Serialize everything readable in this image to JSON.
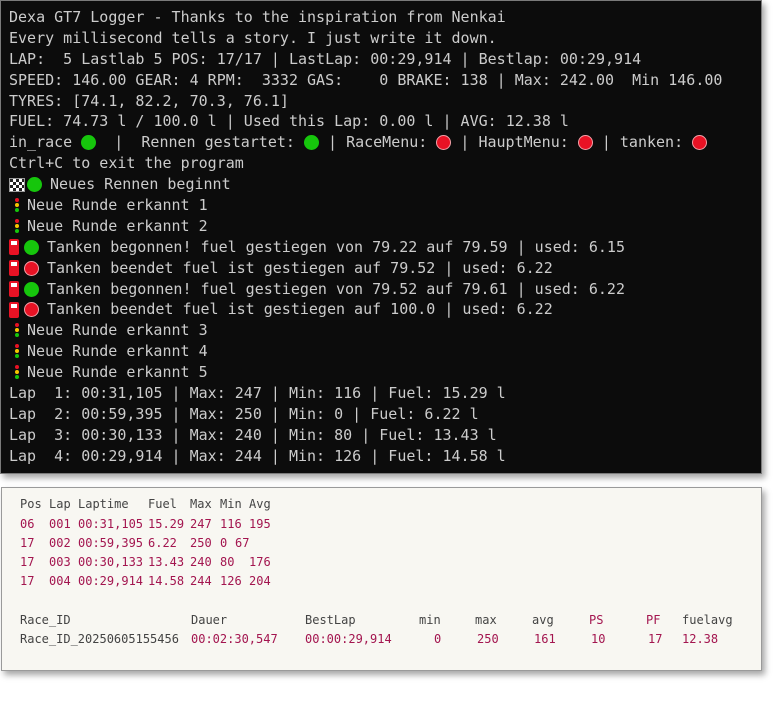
{
  "terminal": {
    "title": "Dexa GT7 Logger - Thanks to the inspiration from Nenkai",
    "tagline": "Every millisecond tells a story. I just write it down.",
    "lap_line": "LAP:  5 Lastlab 5 POS: 17/17 | LastLap: 00:29,914 | Bestlap: 00:29,914",
    "speed_line": "SPEED: 146.00 GEAR: 4 RPM:  3332 GAS:    0 BRAKE: 138 | Max: 242.00  Min 146.00",
    "tyres_line": "TYRES: [74.1, 82.2, 70.3, 76.1]",
    "fuel_line": "FUEL: 74.73 l / 100.0 l | Used this Lap: 0.00 l | AVG: 12.38 l",
    "status": {
      "in_race": "in_race ",
      "sep1": "  |  ",
      "rennen": "Rennen gestartet: ",
      "sep2": " | ",
      "racemenu": "RaceMenu: ",
      "sep3": " | ",
      "hauptmenu": "HauptMenu: ",
      "sep4": " | ",
      "tanken": "tanken: "
    },
    "exit_hint": "Ctrl+C to exit the program",
    "events": [
      {
        "icon": "checkered-flag",
        "dot": "green",
        "text": "Neues Rennen beginnt"
      },
      {
        "icon": "traffic-light",
        "dot": "",
        "text": "Neue Runde erkannt 1"
      },
      {
        "icon": "traffic-light",
        "dot": "",
        "text": "Neue Runde erkannt 2"
      },
      {
        "icon": "fuel-pump",
        "dot": "green",
        "text": "Tanken begonnen! fuel gestiegen von 79.22 auf 79.59 | used: 6.15"
      },
      {
        "icon": "fuel-pump",
        "dot": "red",
        "text": "Tanken beendet fuel ist gestiegen auf 79.52 | used: 6.22"
      },
      {
        "icon": "fuel-pump",
        "dot": "green",
        "text": "Tanken begonnen! fuel gestiegen von 79.52 auf 79.61 | used: 6.22"
      },
      {
        "icon": "fuel-pump",
        "dot": "red",
        "text": "Tanken beendet fuel ist gestiegen auf 100.0 | used: 6.22"
      },
      {
        "icon": "traffic-light",
        "dot": "",
        "text": "Neue Runde erkannt 3"
      },
      {
        "icon": "traffic-light",
        "dot": "",
        "text": "Neue Runde erkannt 4"
      },
      {
        "icon": "traffic-light",
        "dot": "",
        "text": "Neue Runde erkannt 5"
      }
    ],
    "laps": [
      "Lap  1: 00:31,105 | Max: 247 | Min: 116 | Fuel: 15.29 l",
      "Lap  2: 00:59,395 | Max: 250 | Min: 0 | Fuel: 6.22 l",
      "Lap  3: 00:30,133 | Max: 240 | Min: 80 | Fuel: 13.43 l",
      "Lap  4: 00:29,914 | Max: 244 | Min: 126 | Fuel: 14.58 l"
    ],
    "colors": {
      "green": "#16c60c",
      "red": "#e81224",
      "bg": "#0c0c0c",
      "fg": "#cccccc"
    }
  },
  "lap_table": {
    "headers": [
      "Pos",
      "Lap",
      "Laptime",
      "Fuel",
      "Max",
      "Min",
      "Avg"
    ],
    "rows": [
      [
        "06",
        "001",
        "00:31,105",
        "15.29",
        "247",
        "116",
        "195"
      ],
      [
        "17",
        "002",
        "00:59,395",
        "6.22",
        "250",
        "0",
        "67"
      ],
      [
        "17",
        "003",
        "00:30,133",
        "13.43",
        "240",
        "80",
        "176"
      ],
      [
        "17",
        "004",
        "00:29,914",
        "14.58",
        "244",
        "126",
        "204"
      ]
    ]
  },
  "race_table": {
    "headers": [
      "Race_ID",
      "Dauer",
      "BestLap",
      "min",
      "max",
      "avg",
      "PS",
      "PF",
      "fuelavg"
    ],
    "row": [
      "Race_ID_20250605155456",
      "00:02:30,547",
      "00:00:29,914",
      "0",
      "250",
      "161",
      "10",
      "17",
      "12.38"
    ],
    "colors": {
      "label": "#444444",
      "value": "#a3154f"
    }
  }
}
